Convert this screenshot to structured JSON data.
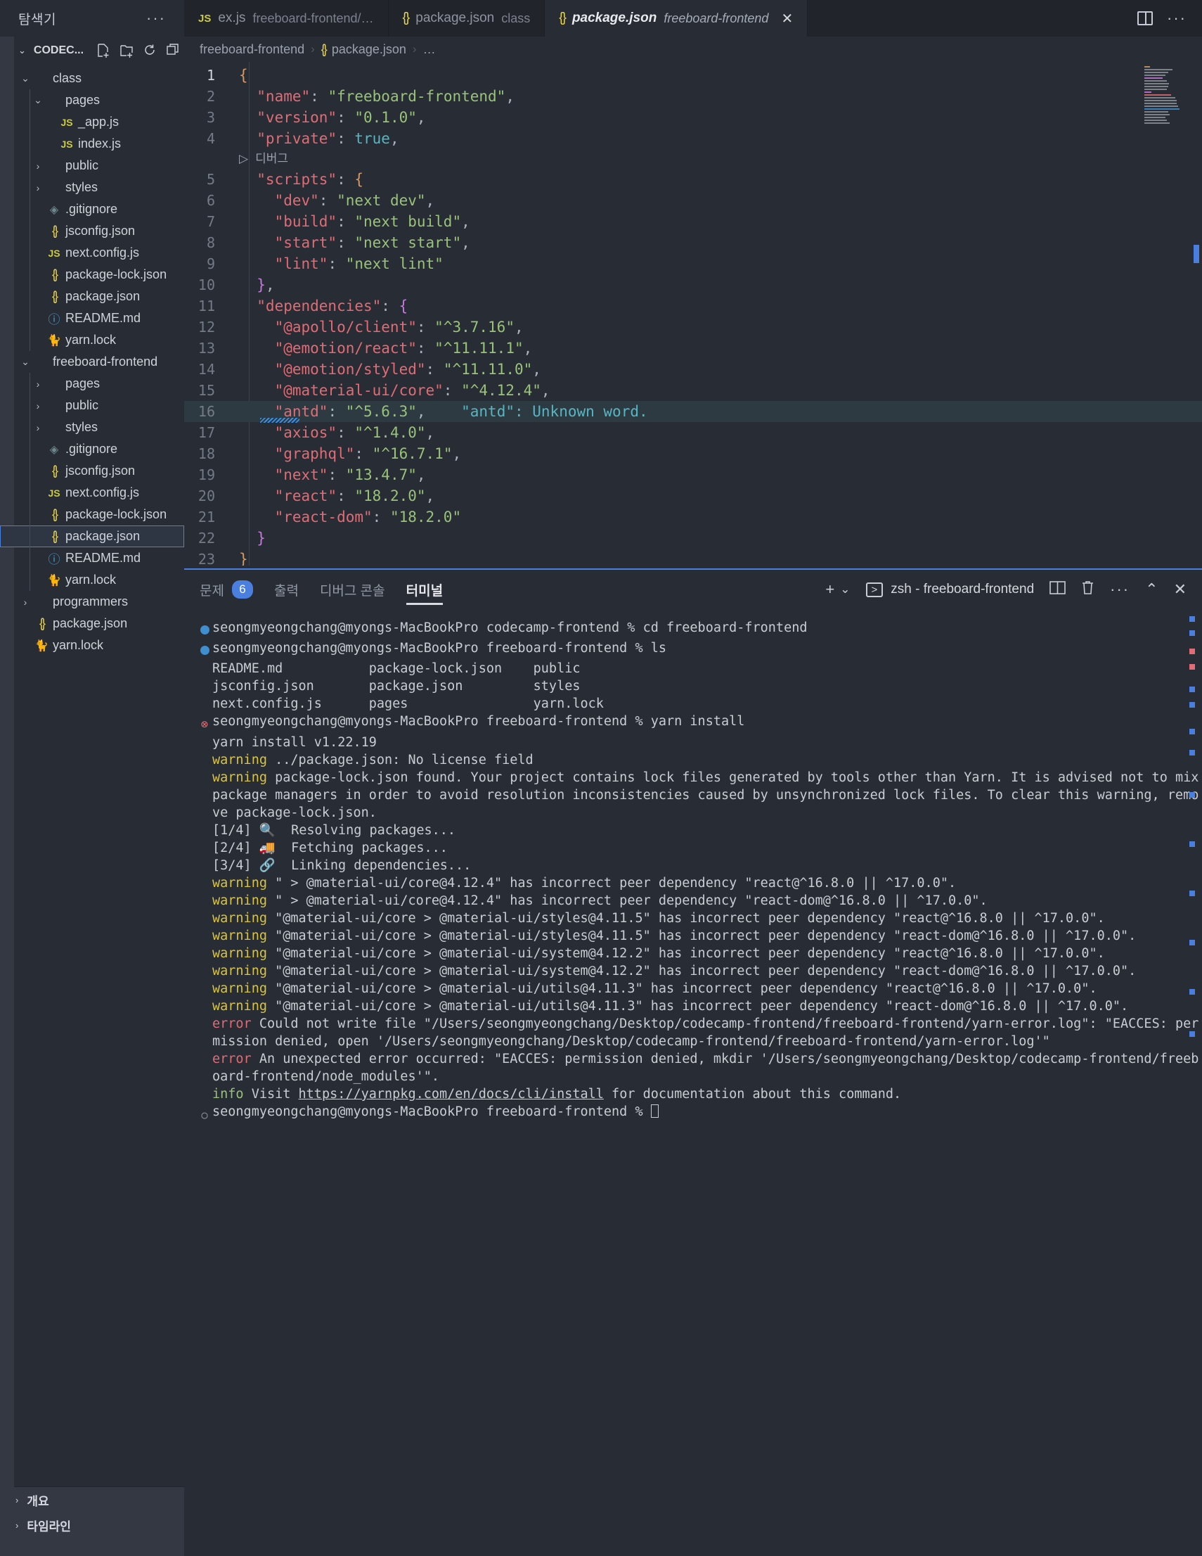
{
  "window": {
    "explorer_label": "탐색기",
    "explorer_more": "···"
  },
  "tabs": [
    {
      "icon": "js-icon",
      "name": "ex.js",
      "detail": "freeboard-frontend/…",
      "active": false,
      "closable": false
    },
    {
      "icon": "json-icon",
      "name": "package.json",
      "detail": "class",
      "active": false,
      "closable": false
    },
    {
      "icon": "json-icon",
      "name": "package.json",
      "detail": "freeboard-frontend",
      "active": true,
      "closable": true
    }
  ],
  "tab_actions": {
    "split_editor": "split-editor-icon",
    "more": "···"
  },
  "sidebar": {
    "title": "CODEC...",
    "head_icons": [
      "new-file-icon",
      "new-folder-icon",
      "refresh-icon",
      "collapse-all-icon"
    ],
    "tree": [
      {
        "indent": 0,
        "chev": "⌄",
        "type": "folder",
        "name": "class"
      },
      {
        "indent": 1,
        "chev": "⌄",
        "type": "folder",
        "name": "pages"
      },
      {
        "indent": 2,
        "chev": "",
        "type": "js",
        "name": "_app.js"
      },
      {
        "indent": 2,
        "chev": "",
        "type": "js",
        "name": "index.js"
      },
      {
        "indent": 1,
        "chev": "›",
        "type": "folder",
        "name": "public"
      },
      {
        "indent": 1,
        "chev": "›",
        "type": "folder",
        "name": "styles"
      },
      {
        "indent": 1,
        "chev": "",
        "type": "git",
        "name": ".gitignore"
      },
      {
        "indent": 1,
        "chev": "",
        "type": "json",
        "name": "jsconfig.json"
      },
      {
        "indent": 1,
        "chev": "",
        "type": "js",
        "name": "next.config.js"
      },
      {
        "indent": 1,
        "chev": "",
        "type": "json",
        "name": "package-lock.json"
      },
      {
        "indent": 1,
        "chev": "",
        "type": "json",
        "name": "package.json"
      },
      {
        "indent": 1,
        "chev": "",
        "type": "md",
        "name": "README.md"
      },
      {
        "indent": 1,
        "chev": "",
        "type": "yarn",
        "name": "yarn.lock"
      },
      {
        "indent": 0,
        "chev": "⌄",
        "type": "folder",
        "name": "freeboard-frontend"
      },
      {
        "indent": 1,
        "chev": "›",
        "type": "folder",
        "name": "pages"
      },
      {
        "indent": 1,
        "chev": "›",
        "type": "folder",
        "name": "public"
      },
      {
        "indent": 1,
        "chev": "›",
        "type": "folder",
        "name": "styles"
      },
      {
        "indent": 1,
        "chev": "",
        "type": "git",
        "name": ".gitignore"
      },
      {
        "indent": 1,
        "chev": "",
        "type": "json",
        "name": "jsconfig.json"
      },
      {
        "indent": 1,
        "chev": "",
        "type": "js",
        "name": "next.config.js"
      },
      {
        "indent": 1,
        "chev": "",
        "type": "json",
        "name": "package-lock.json"
      },
      {
        "indent": 1,
        "chev": "",
        "type": "json",
        "name": "package.json",
        "selected": true
      },
      {
        "indent": 1,
        "chev": "",
        "type": "md",
        "name": "README.md"
      },
      {
        "indent": 1,
        "chev": "",
        "type": "yarn",
        "name": "yarn.lock"
      },
      {
        "indent": 0,
        "chev": "›",
        "type": "folder",
        "name": "programmers"
      },
      {
        "indent": 0,
        "chev": "",
        "type": "json",
        "name": "package.json"
      },
      {
        "indent": 0,
        "chev": "",
        "type": "yarn",
        "name": "yarn.lock"
      }
    ],
    "sections": [
      {
        "chev": "›",
        "label": "개요"
      },
      {
        "chev": "›",
        "label": "타임라인"
      }
    ]
  },
  "breadcrumb": {
    "root": "freeboard-frontend",
    "file": "package.json",
    "tail": "…",
    "sep": "›"
  },
  "editor": {
    "codelens": "디버그",
    "codelens_line_after": 4,
    "inline_hint": "\"antd\": Unknown word.",
    "highlighted_line": 16,
    "lines": [
      {
        "n": 1,
        "tokens": [
          {
            "t": "{",
            "c": "br"
          }
        ]
      },
      {
        "n": 2,
        "tokens": [
          {
            "t": "  \"name\"",
            "c": "k"
          },
          {
            "t": ": ",
            "c": "p"
          },
          {
            "t": "\"freeboard-frontend\"",
            "c": "s"
          },
          {
            "t": ",",
            "c": "p"
          }
        ]
      },
      {
        "n": 3,
        "tokens": [
          {
            "t": "  \"version\"",
            "c": "k"
          },
          {
            "t": ": ",
            "c": "p"
          },
          {
            "t": "\"0.1.0\"",
            "c": "s"
          },
          {
            "t": ",",
            "c": "p"
          }
        ]
      },
      {
        "n": 4,
        "tokens": [
          {
            "t": "  \"private\"",
            "c": "k"
          },
          {
            "t": ": ",
            "c": "p"
          },
          {
            "t": "true",
            "c": "b"
          },
          {
            "t": ",",
            "c": "p"
          }
        ]
      },
      {
        "n": 5,
        "tokens": [
          {
            "t": "  \"scripts\"",
            "c": "k"
          },
          {
            "t": ": ",
            "c": "p"
          },
          {
            "t": "{",
            "c": "br"
          }
        ]
      },
      {
        "n": 6,
        "tokens": [
          {
            "t": "    \"dev\"",
            "c": "k"
          },
          {
            "t": ": ",
            "c": "p"
          },
          {
            "t": "\"next dev\"",
            "c": "s"
          },
          {
            "t": ",",
            "c": "p"
          }
        ]
      },
      {
        "n": 7,
        "tokens": [
          {
            "t": "    \"build\"",
            "c": "k"
          },
          {
            "t": ": ",
            "c": "p"
          },
          {
            "t": "\"next build\"",
            "c": "s"
          },
          {
            "t": ",",
            "c": "p"
          }
        ]
      },
      {
        "n": 8,
        "tokens": [
          {
            "t": "    \"start\"",
            "c": "k"
          },
          {
            "t": ": ",
            "c": "p"
          },
          {
            "t": "\"next start\"",
            "c": "s"
          },
          {
            "t": ",",
            "c": "p"
          }
        ]
      },
      {
        "n": 9,
        "tokens": [
          {
            "t": "    \"lint\"",
            "c": "k"
          },
          {
            "t": ": ",
            "c": "p"
          },
          {
            "t": "\"next lint\"",
            "c": "s"
          }
        ]
      },
      {
        "n": 10,
        "tokens": [
          {
            "t": "  }",
            "c": "brm"
          },
          {
            "t": ",",
            "c": "p"
          }
        ]
      },
      {
        "n": 11,
        "tokens": [
          {
            "t": "  \"dependencies\"",
            "c": "k"
          },
          {
            "t": ": ",
            "c": "p"
          },
          {
            "t": "{",
            "c": "brm"
          }
        ]
      },
      {
        "n": 12,
        "tokens": [
          {
            "t": "    \"@apollo/client\"",
            "c": "k"
          },
          {
            "t": ": ",
            "c": "p"
          },
          {
            "t": "\"^3.7.16\"",
            "c": "s"
          },
          {
            "t": ",",
            "c": "p"
          }
        ]
      },
      {
        "n": 13,
        "tokens": [
          {
            "t": "    \"@emotion/react\"",
            "c": "k"
          },
          {
            "t": ": ",
            "c": "p"
          },
          {
            "t": "\"^11.11.1\"",
            "c": "s"
          },
          {
            "t": ",",
            "c": "p"
          }
        ]
      },
      {
        "n": 14,
        "tokens": [
          {
            "t": "    \"@emotion/styled\"",
            "c": "k"
          },
          {
            "t": ": ",
            "c": "p"
          },
          {
            "t": "\"^11.11.0\"",
            "c": "s"
          },
          {
            "t": ",",
            "c": "p"
          }
        ]
      },
      {
        "n": 15,
        "tokens": [
          {
            "t": "    \"@material-ui/core\"",
            "c": "k"
          },
          {
            "t": ": ",
            "c": "p"
          },
          {
            "t": "\"^4.12.4\"",
            "c": "s"
          },
          {
            "t": ",",
            "c": "p"
          }
        ]
      },
      {
        "n": 16,
        "tokens": [
          {
            "t": "    \"antd\"",
            "c": "k"
          },
          {
            "t": ": ",
            "c": "p"
          },
          {
            "t": "\"^5.6.3\"",
            "c": "s"
          },
          {
            "t": ",",
            "c": "p"
          }
        ],
        "hint": "    \"antd\": Unknown word."
      },
      {
        "n": 17,
        "tokens": [
          {
            "t": "    \"axios\"",
            "c": "k"
          },
          {
            "t": ": ",
            "c": "p"
          },
          {
            "t": "\"^1.4.0\"",
            "c": "s"
          },
          {
            "t": ",",
            "c": "p"
          }
        ]
      },
      {
        "n": 18,
        "tokens": [
          {
            "t": "    \"graphql\"",
            "c": "k"
          },
          {
            "t": ": ",
            "c": "p"
          },
          {
            "t": "\"^16.7.1\"",
            "c": "s"
          },
          {
            "t": ",",
            "c": "p"
          }
        ]
      },
      {
        "n": 19,
        "tokens": [
          {
            "t": "    \"next\"",
            "c": "k"
          },
          {
            "t": ": ",
            "c": "p"
          },
          {
            "t": "\"13.4.7\"",
            "c": "s"
          },
          {
            "t": ",",
            "c": "p"
          }
        ]
      },
      {
        "n": 20,
        "tokens": [
          {
            "t": "    \"react\"",
            "c": "k"
          },
          {
            "t": ": ",
            "c": "p"
          },
          {
            "t": "\"18.2.0\"",
            "c": "s"
          },
          {
            "t": ",",
            "c": "p"
          }
        ]
      },
      {
        "n": 21,
        "tokens": [
          {
            "t": "    \"react-dom\"",
            "c": "k"
          },
          {
            "t": ": ",
            "c": "p"
          },
          {
            "t": "\"18.2.0\"",
            "c": "s"
          }
        ]
      },
      {
        "n": 22,
        "tokens": [
          {
            "t": "  }",
            "c": "brm"
          }
        ]
      },
      {
        "n": 23,
        "tokens": [
          {
            "t": "}",
            "c": "br"
          }
        ]
      }
    ]
  },
  "panel": {
    "tabs": [
      {
        "label": "문제",
        "badge": "6",
        "active": false
      },
      {
        "label": "출력",
        "badge": "",
        "active": false
      },
      {
        "label": "디버그 콘솔",
        "badge": "",
        "active": false
      },
      {
        "label": "터미널",
        "badge": "",
        "active": true
      }
    ],
    "actions": {
      "new_terminal": "+",
      "new_terminal_chevron": "⌄",
      "terminal_name": "zsh - freeboard-frontend",
      "split": "split-terminal-icon",
      "kill": "trash-icon",
      "more": "···",
      "maximize": "⌃",
      "close": "✕"
    },
    "terminal_lines": [
      {
        "mark": "dot",
        "segs": [
          {
            "t": "seongmyeongchang@myongs-MacBookPro codecamp-frontend % cd freeboard-frontend",
            "c": ""
          }
        ]
      },
      {
        "mark": "dot",
        "segs": [
          {
            "t": "seongmyeongchang@myongs-MacBookPro freeboard-frontend % ls",
            "c": ""
          }
        ]
      },
      {
        "mark": "",
        "segs": [
          {
            "t": "README.md           package-lock.json    public",
            "c": ""
          }
        ]
      },
      {
        "mark": "",
        "segs": [
          {
            "t": "jsconfig.json       package.json         styles",
            "c": ""
          }
        ]
      },
      {
        "mark": "",
        "segs": [
          {
            "t": "next.config.js      pages                yarn.lock",
            "c": ""
          }
        ]
      },
      {
        "mark": "x",
        "segs": [
          {
            "t": "seongmyeongchang@myongs-MacBookPro freeboard-frontend % yarn install",
            "c": ""
          }
        ]
      },
      {
        "mark": "",
        "segs": [
          {
            "t": "yarn install v1.22.19",
            "c": ""
          }
        ]
      },
      {
        "mark": "",
        "segs": [
          {
            "t": "warning",
            "c": "warn"
          },
          {
            "t": " ../package.json: No license field",
            "c": ""
          }
        ]
      },
      {
        "mark": "",
        "segs": [
          {
            "t": "warning",
            "c": "warn"
          },
          {
            "t": " package-lock.json found. Your project contains lock files generated by tools other than Yarn. It is advised not to mix package managers in order to avoid resolution inconsistencies caused by unsynchronized lock files. To clear this warning, remove package-lock.json.",
            "c": ""
          }
        ]
      },
      {
        "mark": "",
        "segs": [
          {
            "t": "[1/4] 🔍  Resolving packages...",
            "c": ""
          }
        ]
      },
      {
        "mark": "",
        "segs": [
          {
            "t": "[2/4] 🚚  Fetching packages...",
            "c": ""
          }
        ]
      },
      {
        "mark": "",
        "segs": [
          {
            "t": "[3/4] 🔗  Linking dependencies...",
            "c": ""
          }
        ]
      },
      {
        "mark": "",
        "segs": [
          {
            "t": "warning",
            "c": "warn"
          },
          {
            "t": " \" > @material-ui/core@4.12.4\" has incorrect peer dependency \"react@^16.8.0 || ^17.0.0\".",
            "c": ""
          }
        ]
      },
      {
        "mark": "",
        "segs": [
          {
            "t": "warning",
            "c": "warn"
          },
          {
            "t": " \" > @material-ui/core@4.12.4\" has incorrect peer dependency \"react-dom@^16.8.0 || ^17.0.0\".",
            "c": ""
          }
        ]
      },
      {
        "mark": "",
        "segs": [
          {
            "t": "warning",
            "c": "warn"
          },
          {
            "t": " \"@material-ui/core > @material-ui/styles@4.11.5\" has incorrect peer dependency \"react@^16.8.0 || ^17.0.0\".",
            "c": ""
          }
        ]
      },
      {
        "mark": "",
        "segs": [
          {
            "t": "warning",
            "c": "warn"
          },
          {
            "t": " \"@material-ui/core > @material-ui/styles@4.11.5\" has incorrect peer dependency \"react-dom@^16.8.0 || ^17.0.0\".",
            "c": ""
          }
        ]
      },
      {
        "mark": "",
        "segs": [
          {
            "t": "warning",
            "c": "warn"
          },
          {
            "t": " \"@material-ui/core > @material-ui/system@4.12.2\" has incorrect peer dependency \"react@^16.8.0 || ^17.0.0\".",
            "c": ""
          }
        ]
      },
      {
        "mark": "",
        "segs": [
          {
            "t": "warning",
            "c": "warn"
          },
          {
            "t": " \"@material-ui/core > @material-ui/system@4.12.2\" has incorrect peer dependency \"react-dom@^16.8.0 || ^17.0.0\".",
            "c": ""
          }
        ]
      },
      {
        "mark": "",
        "segs": [
          {
            "t": "warning",
            "c": "warn"
          },
          {
            "t": " \"@material-ui/core > @material-ui/utils@4.11.3\" has incorrect peer dependency \"react@^16.8.0 || ^17.0.0\".",
            "c": ""
          }
        ]
      },
      {
        "mark": "",
        "segs": [
          {
            "t": "warning",
            "c": "warn"
          },
          {
            "t": " \"@material-ui/core > @material-ui/utils@4.11.3\" has incorrect peer dependency \"react-dom@^16.8.0 || ^17.0.0\".",
            "c": ""
          }
        ]
      },
      {
        "mark": "",
        "segs": [
          {
            "t": "error",
            "c": "err"
          },
          {
            "t": " Could not write file \"/Users/seongmyeongchang/Desktop/codecamp-frontend/freeboard-frontend/yarn-error.log\": \"EACCES: permission denied, open '/Users/seongmyeongchang/Desktop/codecamp-frontend/freeboard-frontend/yarn-error.log'\"",
            "c": ""
          }
        ]
      },
      {
        "mark": "",
        "segs": [
          {
            "t": "error",
            "c": "err"
          },
          {
            "t": " An unexpected error occurred: \"EACCES: permission denied, mkdir '/Users/seongmyeongchang/Desktop/codecamp-frontend/freeboard-frontend/node_modules'\".",
            "c": ""
          }
        ]
      },
      {
        "mark": "",
        "segs": [
          {
            "t": "info",
            "c": "info"
          },
          {
            "t": " Visit ",
            "c": ""
          },
          {
            "t": "https://yarnpkg.com/en/docs/cli/install",
            "c": "ul"
          },
          {
            "t": " for documentation about this command.",
            "c": ""
          }
        ]
      },
      {
        "mark": "o",
        "segs": [
          {
            "t": "seongmyeongchang@myongs-MacBookPro freeboard-frontend % ",
            "c": ""
          },
          {
            "t": "█",
            "c": "cursorbox"
          }
        ]
      }
    ]
  },
  "colors": {
    "accent": "#4a7fe0",
    "bg": "#282c34",
    "bg_dark": "#21252b",
    "warn": "#d8c441",
    "error": "#e06c75",
    "info": "#98c379",
    "string": "#98c379",
    "key": "#e06c75",
    "boolean": "#56b6c2"
  }
}
